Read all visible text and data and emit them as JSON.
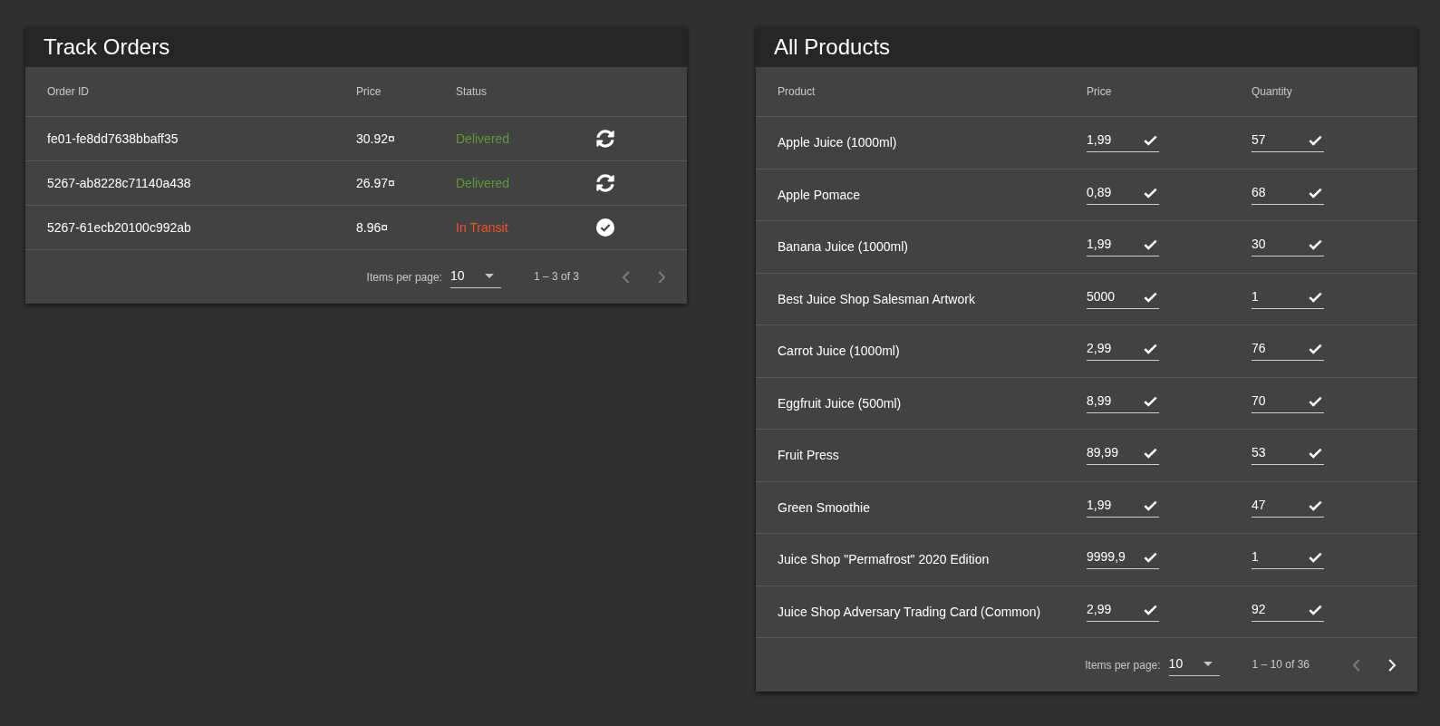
{
  "track_orders": {
    "title": "Track Orders",
    "columns": [
      "Order ID",
      "Price",
      "Status"
    ],
    "rows": [
      {
        "order_id": "fe01-fe8dd7638bbaff35",
        "price": "30.92¤",
        "status": "Delivered",
        "color": "#5e9b3b",
        "kind": "delivered"
      },
      {
        "order_id": "5267-ab8228c71140a438",
        "price": "26.97¤",
        "status": "Delivered",
        "color": "#5e9b3b",
        "kind": "delivered"
      },
      {
        "order_id": "5267-61ecb20100c992ab",
        "price": "8.96¤",
        "status": "In Transit",
        "color": "#f4502a",
        "kind": "in_transit"
      }
    ],
    "paginator": {
      "label": "Items per page:",
      "page_size": "10",
      "range": "1 – 3 of 3",
      "previous_disabled": true,
      "next_disabled": true
    }
  },
  "all_products": {
    "title": "All Products",
    "columns": [
      "Product",
      "Price",
      "Quantity"
    ],
    "rows": [
      {
        "product": "Apple Juice (1000ml)",
        "price": "1,99",
        "quantity": "57"
      },
      {
        "product": "Apple Pomace",
        "price": "0,89",
        "quantity": "68"
      },
      {
        "product": "Banana Juice (1000ml)",
        "price": "1,99",
        "quantity": "30"
      },
      {
        "product": "Best Juice Shop Salesman Artwork",
        "price": "5000",
        "quantity": "1"
      },
      {
        "product": "Carrot Juice (1000ml)",
        "price": "2,99",
        "quantity": "76"
      },
      {
        "product": "Eggfruit Juice (500ml)",
        "price": "8,99",
        "quantity": "70"
      },
      {
        "product": "Fruit Press",
        "price": "89,99",
        "quantity": "53"
      },
      {
        "product": "Green Smoothie",
        "price": "1,99",
        "quantity": "47"
      },
      {
        "product": "Juice Shop \"Permafrost\" 2020 Edition",
        "price": "9999,9",
        "quantity": "1"
      },
      {
        "product": "Juice Shop Adversary Trading Card (Common)",
        "price": "2,99",
        "quantity": "92"
      }
    ],
    "paginator": {
      "label": "Items per page:",
      "page_size": "10",
      "range": "1 – 10 of 36",
      "previous_disabled": true,
      "next_disabled": false
    }
  }
}
